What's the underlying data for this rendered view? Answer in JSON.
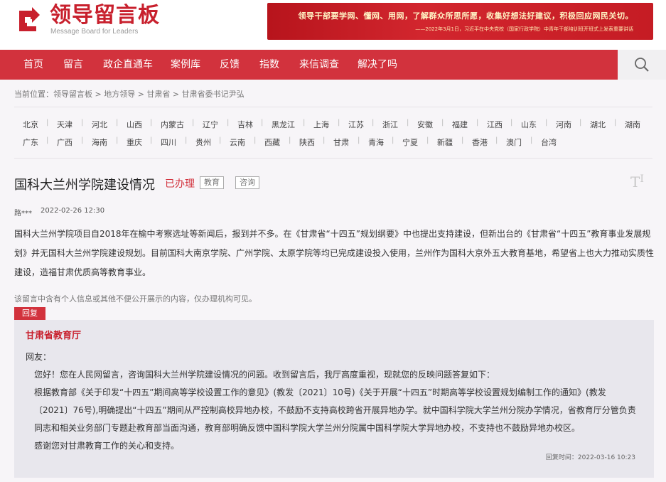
{
  "header": {
    "logo_title": "领导留言板",
    "logo_subtitle": "Message Board for Leaders",
    "banner_line1": "领导干部要学网、懂网、用网，了解群众所思所愿，收集好想法好建议，积极回应网民关切。",
    "banner_line2": "——2022年3月1日，习近平在中央党校（国家行政学院）中青年干部培训班开班式上发表重要讲话"
  },
  "nav": {
    "items": [
      "首页",
      "留言",
      "政企直通车",
      "案例库",
      "反馈",
      "指数",
      "来信调查",
      "解决了吗"
    ],
    "search_icon": "search-icon"
  },
  "breadcrumb": {
    "prefix": "当前位置：",
    "items": [
      "领导留言板",
      "地方领导",
      "甘肃省",
      "甘肃省委书记尹弘"
    ],
    "separator": " > "
  },
  "provinces": {
    "row1": [
      "北京",
      "天津",
      "河北",
      "山西",
      "内蒙古",
      "辽宁",
      "吉林",
      "黑龙江",
      "上海",
      "江苏",
      "浙江",
      "安徽",
      "福建",
      "江西",
      "山东",
      "河南",
      "湖北",
      "湖南"
    ],
    "row2": [
      "广东",
      "广西",
      "海南",
      "重庆",
      "四川",
      "贵州",
      "云南",
      "西藏",
      "陕西",
      "甘肃",
      "青海",
      "宁夏",
      "新疆",
      "香港",
      "澳门",
      "台湾"
    ]
  },
  "post": {
    "title": "国科大兰州学院建设情况",
    "status": "已办理",
    "tags": [
      "教育",
      "咨询"
    ],
    "font_toggle": "T",
    "author": "路***",
    "date": "2022-02-26 12:30",
    "content": "国科大兰州学院项目自2018年在榆中考察选址等新闻后，报到并不多。在《甘肃省“十四五”规划纲要》中也提出支持建设，但新出台的《甘肃省“十四五”教育事业发展规划》并无国科大兰州学院建设规划。目前国科大南京学院、广州学院、太原学院等均已完成建设投入使用，兰州作为国科大京外五大教育基地，希望省上也大力推动实质性建设，造福甘肃优质高等教育事业。",
    "privacy_note": "该留言中含有个人信息或其他不便公开展示的内容，仅办理机构可见。"
  },
  "reply": {
    "tab_label": "回复",
    "department": "甘肃省教育厅",
    "greeting": "网友：",
    "paragraph1": "您好！您在人民网留言，咨询国科大兰州学院建设情况的问题。收到留言后，我厅高度重视，现就您的反映问题答复如下：",
    "paragraph2": "根据教育部《关于印发“十四五”期间高等学校设置工作的意见》(教发〔2021〕10号)《关于开展“十四五”时期高等学校设置规划编制工作的通知》(教发〔2021〕76号),明确提出“十四五”期间从严控制高校异地办校，不鼓励不支持高校跨省开展异地办学。就中国科学院大学兰州分院办学情况，省教育厅分管负责同志和相关业务部门专题赴教育部当面沟通，教育部明确反馈中国科学院大学兰州分院属中国科学院大学异地办校，不支持也不鼓励异地办校区。",
    "paragraph3": "感谢您对甘肃教育工作的关心和支持。",
    "time_label": "回复时间：",
    "time": "2022-03-16 10:23"
  },
  "colors": {
    "brand_red": "#d2323d",
    "logo_red": "#c8202d"
  }
}
